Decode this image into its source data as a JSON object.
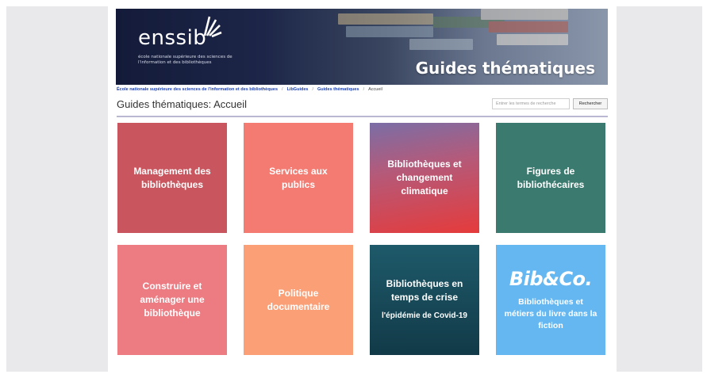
{
  "banner": {
    "logo": "enssib",
    "logo_subtitle": "école nationale supérieure des sciences de l'information et des bibliothèques",
    "title": "Guides thématiques"
  },
  "breadcrumb": [
    "École nationale supérieure des sciences de l'information et des bibliothèques",
    "LibGuides",
    "Guides thématiques",
    "Accueil"
  ],
  "header": {
    "page_title": "Guides thématiques: Accueil",
    "search_placeholder": "Entrer les termes de recherche",
    "search_button": "Rechercher"
  },
  "tiles": [
    {
      "label": "Management des bibliothèques",
      "color": "#c9565e"
    },
    {
      "label": "Services aux publics",
      "color": "#f47b72"
    },
    {
      "label": "Bibliothèques et changement climatique",
      "color": "#e53b3b"
    },
    {
      "label": "Figures de bibliothécaires",
      "color": "#3b7a6f"
    },
    {
      "label": "Construire et aménager une bibliothèque",
      "color": "#ec7b82"
    },
    {
      "label": "Politique documentaire",
      "color": "#fb9f77"
    },
    {
      "label": "Bibliothèques en temps de crise",
      "sublabel": "l'épidémie de Covid-19",
      "color": "#1e5a6a"
    },
    {
      "logo": "Bib&Co.",
      "label": "Bibliothèques et métiers du livre dans la fiction",
      "color": "#64b7f0"
    }
  ]
}
